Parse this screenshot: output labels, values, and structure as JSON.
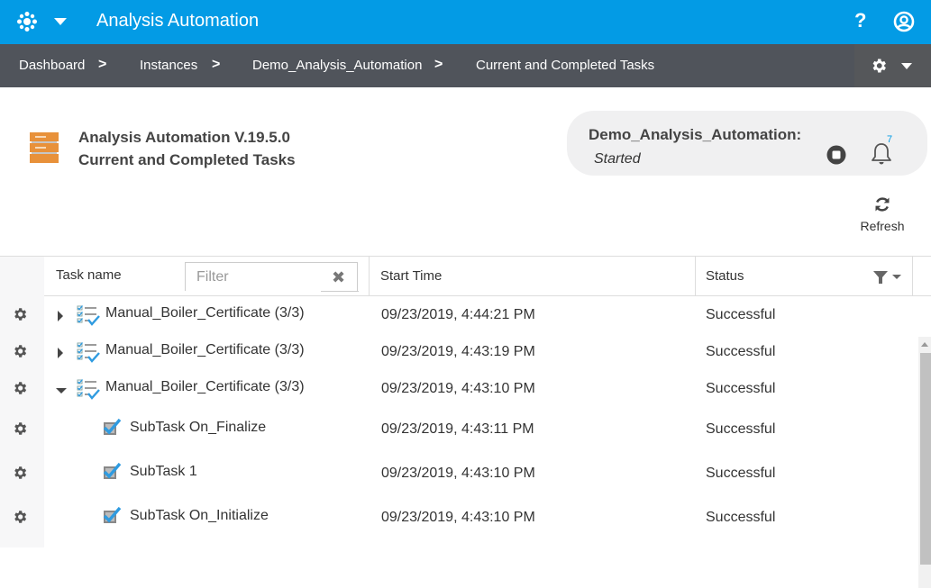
{
  "topbar": {
    "app_title": "Analysis Automation",
    "help_glyph": "?",
    "accent_color": "#039be5"
  },
  "breadcrumb": [
    {
      "label": "Dashboard"
    },
    {
      "label": "Instances"
    },
    {
      "label": "Demo_Analysis_Automation"
    },
    {
      "label": "Current and Completed Tasks"
    }
  ],
  "breadcrumb_separator": ">",
  "page": {
    "title_line1": "Analysis Automation V.19.5.0",
    "title_line2": "Current and Completed Tasks"
  },
  "instance": {
    "name": "Demo_Analysis_Automation:",
    "status": "Started",
    "notification_count": "7"
  },
  "refresh": {
    "label": "Refresh"
  },
  "grid": {
    "columns": {
      "task_name": "Task name",
      "start_time": "Start Time",
      "status": "Status"
    },
    "filter": {
      "placeholder": "Filter",
      "value": ""
    },
    "rows": [
      {
        "type": "task",
        "expanded": false,
        "name": "Manual_Boiler_Certificate (3/3)",
        "start_time": "09/23/2019, 4:44:21 PM",
        "status": "Successful"
      },
      {
        "type": "task",
        "expanded": false,
        "name": "Manual_Boiler_Certificate (3/3)",
        "start_time": "09/23/2019, 4:43:19 PM",
        "status": "Successful"
      },
      {
        "type": "task",
        "expanded": true,
        "name": "Manual_Boiler_Certificate (3/3)",
        "start_time": "09/23/2019, 4:43:10 PM",
        "status": "Successful"
      },
      {
        "type": "subtask",
        "name": "SubTask On_Finalize",
        "start_time": "09/23/2019, 4:43:11 PM",
        "status": "Successful"
      },
      {
        "type": "subtask",
        "name": "SubTask 1",
        "start_time": "09/23/2019, 4:43:10 PM",
        "status": "Successful"
      },
      {
        "type": "subtask",
        "name": "SubTask On_Initialize",
        "start_time": "09/23/2019, 4:43:10 PM",
        "status": "Successful"
      }
    ]
  },
  "icons": {
    "app_logo": "asterisk-gear-icon",
    "help": "question-icon",
    "user": "user-circle-icon",
    "settings": "gear-icon",
    "app": "server-stack-icon",
    "stop": "stop-circle-icon",
    "bell": "bell-icon",
    "refresh": "refresh-icon",
    "clear": "close-icon",
    "filter": "funnel-icon",
    "task": "checklist-icon",
    "subtask": "checked-box-icon"
  }
}
